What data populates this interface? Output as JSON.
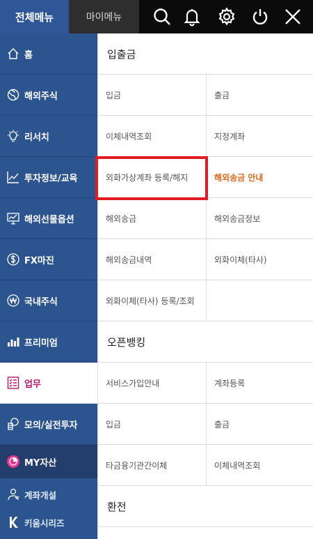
{
  "tabs": {
    "all_menu": "전체메뉴",
    "my_menu": "마이메뉴"
  },
  "top_icons": [
    "search-icon",
    "bell-icon",
    "gear-icon",
    "power-icon",
    "close-icon"
  ],
  "sidebar": {
    "items": [
      {
        "label": "홈",
        "icon": "home-icon"
      },
      {
        "label": "해외주식",
        "icon": "globe-icon"
      },
      {
        "label": "리서치",
        "icon": "bulb-icon"
      },
      {
        "label": "투자정보/교육",
        "icon": "line-chart-icon"
      },
      {
        "label": "해외선물옵션",
        "icon": "monitor-chart-icon"
      },
      {
        "label": "FX마진",
        "icon": "dollar-icon"
      },
      {
        "label": "국내주식",
        "icon": "won-icon"
      },
      {
        "label": "프리미엄",
        "icon": "bar-chart-icon"
      },
      {
        "label": "업무",
        "icon": "checklist-icon"
      },
      {
        "label": "모의/실전투자",
        "icon": "coins-icon"
      },
      {
        "label": "MY자산",
        "icon": "pie-icon"
      },
      {
        "label": "계좌개설",
        "icon": "person-icon"
      },
      {
        "label": "키움시리즈",
        "icon": "k-icon"
      }
    ]
  },
  "content": {
    "sections": [
      {
        "title": "입출금",
        "cells": [
          "입금",
          "출금",
          "이체내역조회",
          "지정계좌",
          "외화가상계좌 등록/해지",
          "해외송금 안내",
          "해외송금",
          "해외송금정보",
          "해외송금내역",
          "외화이체(타사)",
          "외화이체(타사) 등록/조회",
          ""
        ]
      },
      {
        "title": "오픈뱅킹",
        "cells": [
          "서비스가입안내",
          "계좌등록",
          "입금",
          "출금",
          "타금융기관간이체",
          "이체내역조회"
        ]
      },
      {
        "title": "환전",
        "cells": []
      }
    ]
  },
  "colors": {
    "accent": "#2f5697",
    "active_text": "#b0176b",
    "highlight_text": "#e0661b",
    "highlight_box": "#e21c23"
  }
}
